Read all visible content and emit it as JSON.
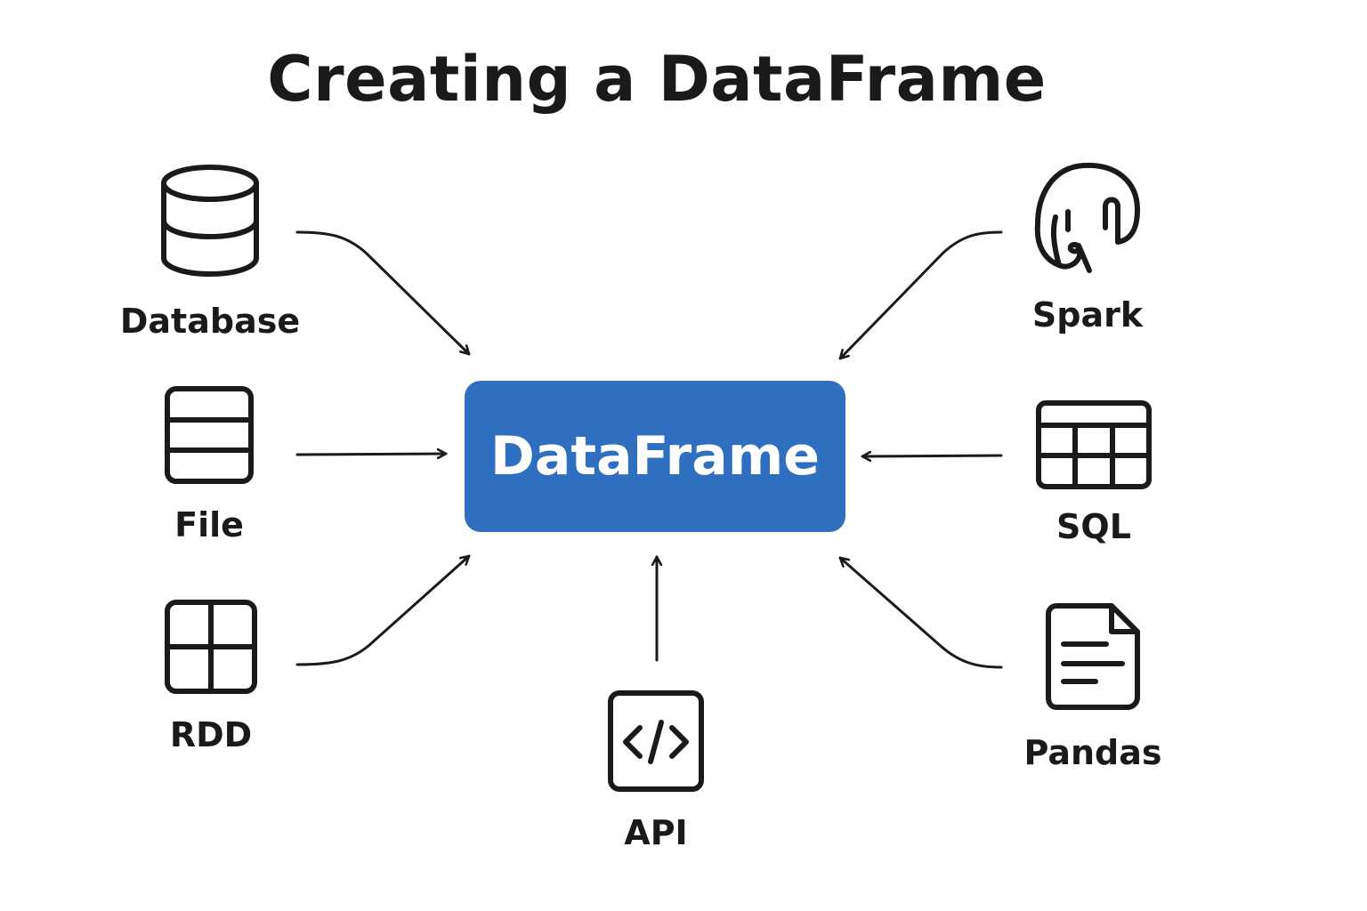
{
  "title": "Creating a DataFrame",
  "hub": {
    "label": "DataFrame",
    "color": "#2f6fbf"
  },
  "sources": {
    "database": {
      "label": "Database",
      "icon": "database-icon"
    },
    "file": {
      "label": "File",
      "icon": "file-rows-icon"
    },
    "rdd": {
      "label": "RDD",
      "icon": "grid-icon"
    },
    "api": {
      "label": "API",
      "icon": "code-icon"
    },
    "spark": {
      "label": "Spark",
      "icon": "elephant-icon"
    },
    "sql": {
      "label": "SQL",
      "icon": "table-icon"
    },
    "pandas": {
      "label": "Pandas",
      "icon": "document-icon"
    }
  },
  "colors": {
    "stroke": "#1a1a1a",
    "hub": "#2f6fbf",
    "background": "#ffffff"
  }
}
